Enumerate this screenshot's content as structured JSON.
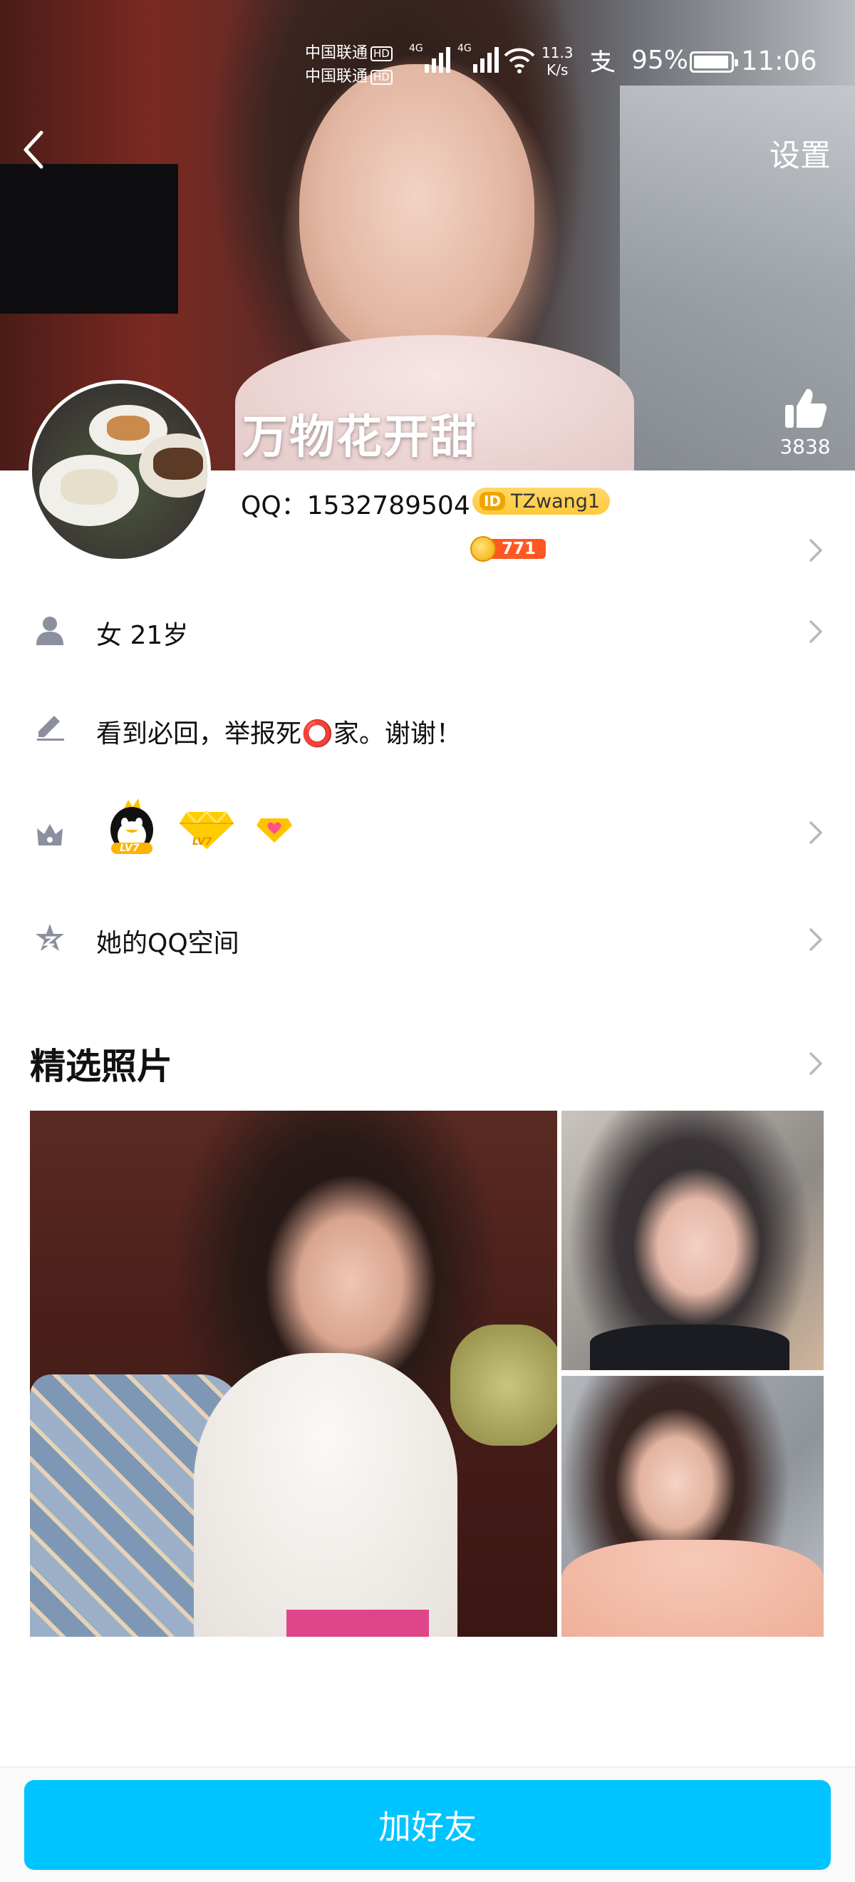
{
  "status_bar": {
    "carrier_1": "中国联通",
    "carrier_2": "中国联通",
    "hd": "HD",
    "network": "4G",
    "speed_value": "11.3",
    "speed_unit": "K/s",
    "battery": "95%",
    "battery_level": 0.95,
    "time": "11:06"
  },
  "nav": {
    "back_icon": "chevron-left-icon",
    "settings_label": "设置"
  },
  "profile": {
    "nickname": "万物花开甜",
    "likes": "3838",
    "qq_label": "QQ：",
    "qq_number": "1532789504",
    "id_badge": "ID",
    "qid": "TZwang1",
    "coin_value": "771"
  },
  "rows": {
    "gender_age": "女  21岁",
    "signature": "看到必回，举报死⭕家。谢谢！",
    "badges": [
      "LV7",
      "LV7"
    ],
    "qzone": "她的QQ空间"
  },
  "photos": {
    "title": "精选照片"
  },
  "actions": {
    "add_friend": "加好友"
  },
  "colors": {
    "accent": "#00c4ff",
    "coin": "#ff5722",
    "qid_bg": "#ffd86b",
    "icon_gray": "#8b8f9e",
    "chevron": "#b5b8bf"
  }
}
